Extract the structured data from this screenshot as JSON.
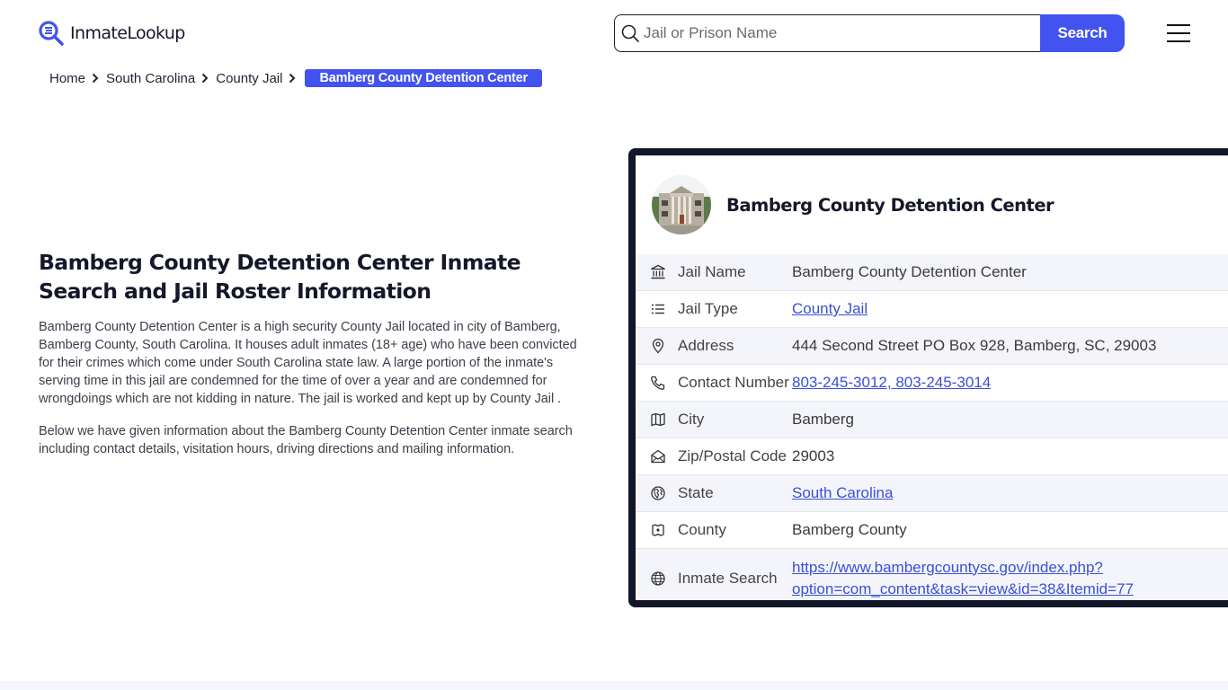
{
  "header": {
    "logo_text": "InmateLookup",
    "search": {
      "placeholder": "Jail or Prison Name",
      "value": "",
      "button_label": "Search"
    },
    "brand_color": "#4253f0"
  },
  "breadcrumb": {
    "items": [
      {
        "label": "Home"
      },
      {
        "label": "South Carolina"
      },
      {
        "label": "County Jail"
      }
    ],
    "current": "Bamberg County Detention Center"
  },
  "intro": {
    "title": "Bamberg County Detention Center Inmate Search and Jail Roster Information",
    "paragraphs": [
      "Bamberg County Detention Center is a high security County Jail located in city of Bamberg, Bamberg County, South Carolina. It houses adult inmates (18+ age) who have been convicted for their crimes which come under South Carolina state law. A large portion of the inmate's serving time in this jail are condemned for the time of over a year and are condemned for wrongdoings which are not kidding in nature. The jail is worked and kept up by County Jail .",
      "Below we have given information about the Bamberg County Detention Center inmate search including contact details, visitation hours, driving directions and mailing information."
    ]
  },
  "card": {
    "title": "Bamberg County Detention Center",
    "rows": [
      {
        "icon": "building-columns-icon",
        "label": "Jail Name",
        "value": "Bamberg County Detention Center",
        "link": false
      },
      {
        "icon": "list-icon",
        "label": "Jail Type",
        "value": "County Jail",
        "link": true
      },
      {
        "icon": "map-pin-icon",
        "label": "Address",
        "value": "444 Second Street PO Box 928, Bamberg, SC, 29003",
        "link": false
      },
      {
        "icon": "phone-icon",
        "label": "Contact Number",
        "value": "803-245-3012, 803-245-3014",
        "link": true
      },
      {
        "icon": "map-icon",
        "label": "City",
        "value": "Bamberg",
        "link": false
      },
      {
        "icon": "mail-open-icon",
        "label": "Zip/Postal Code",
        "value": "29003",
        "link": false
      },
      {
        "icon": "globe-region-icon",
        "label": "State",
        "value": "South Carolina",
        "link": true
      },
      {
        "icon": "county-badge-icon",
        "label": "County",
        "value": "Bamberg County",
        "link": false
      },
      {
        "icon": "world-icon",
        "label": "Inmate Search",
        "value": "https://www.bambergcountysc.gov/index.php?option=com_content&task=view&id=38&Itemid=77",
        "value_line1": "https://www.bambergcountysc.gov/index.php?",
        "value_line2": "option=com_content&task=view&id=38&Itemid=77",
        "link": true
      }
    ]
  }
}
